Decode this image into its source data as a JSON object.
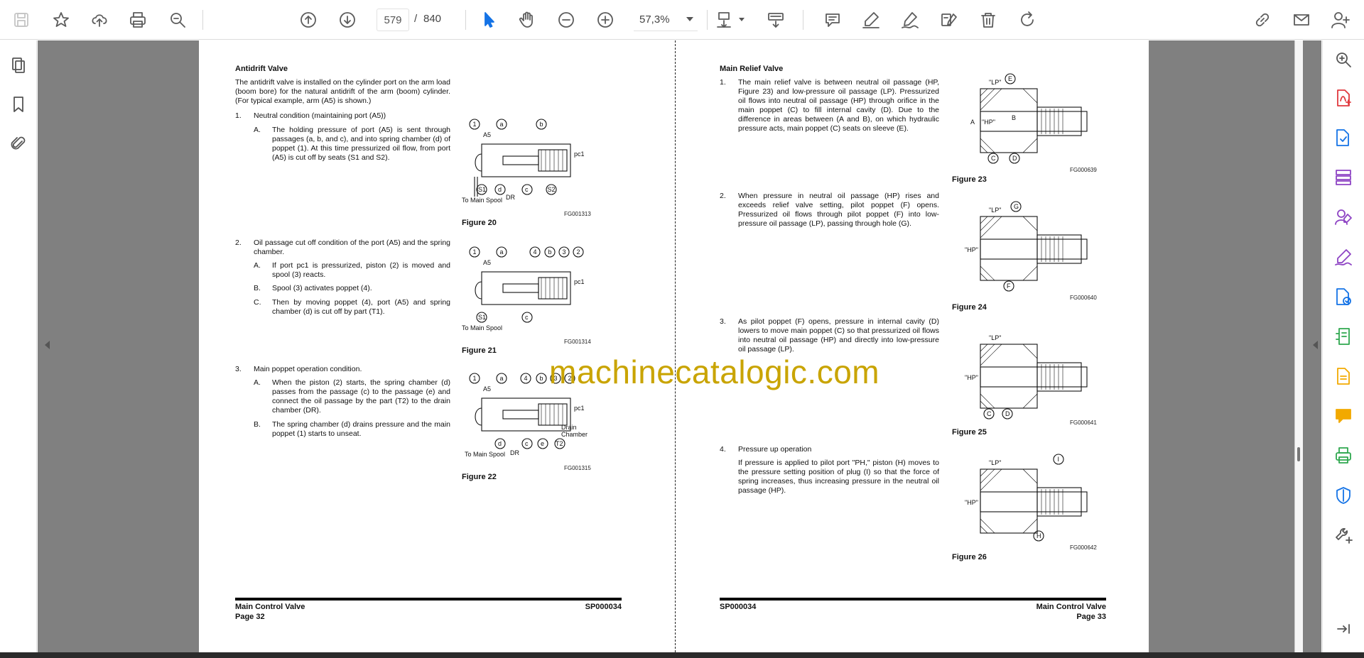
{
  "toolbar": {
    "page_current": "579",
    "page_separator": "/",
    "page_total": "840",
    "zoom": "57,3%"
  },
  "left_page": {
    "heading": "Antidrift Valve",
    "intro": "The antidrift valve is installed on the cylinder port on the arm load (boom bore) for the natural antidrift of the arm (boom) cylinder. (For typical example, arm (A5) is shown.)",
    "items": [
      {
        "num": "1.",
        "title": "Neutral condition (maintaining port (A5))",
        "subs": [
          {
            "letter": "A.",
            "text": "The holding pressure of port (A5) is sent through passages (a, b, and c), and into spring chamber (d) of poppet (1). At this time pressurized oil flow, from port (A5) is cut off by seats (S1 and S2)."
          }
        ]
      },
      {
        "num": "2.",
        "title": "Oil passage cut off condition of the port (A5) and the spring chamber.",
        "subs": [
          {
            "letter": "A.",
            "text": "If port pc1 is pressurized, piston (2) is moved and spool (3) reacts."
          },
          {
            "letter": "B.",
            "text": "Spool (3) activates poppet (4)."
          },
          {
            "letter": "C.",
            "text": "Then by moving poppet (4), port (A5) and spring chamber (d) is cut off by part (T1)."
          }
        ]
      },
      {
        "num": "3.",
        "title": "Main poppet operation condition.",
        "subs": [
          {
            "letter": "A.",
            "text": "When the piston (2) starts, the spring chamber (d) passes from the passage (c) to the passage (e) and connect the oil passage by the part (T2) to the drain chamber (DR)."
          },
          {
            "letter": "B.",
            "text": "The spring chamber (d) drains pressure and the main poppet (1) starts to unseat."
          }
        ]
      }
    ],
    "figures": [
      {
        "code": "FG001313",
        "caption": "Figure 20",
        "labels": [
          "1",
          "a",
          "b",
          "A5",
          "pc1",
          "S1",
          "d",
          "c",
          "S2",
          "DR",
          "To Main Spool"
        ]
      },
      {
        "code": "FG001314",
        "caption": "Figure 21",
        "labels": [
          "1",
          "a",
          "4",
          "b",
          "3",
          "2",
          "A5",
          "pc1",
          "S1",
          "c",
          "To Main Spool"
        ]
      },
      {
        "code": "FG001315",
        "caption": "Figure 22",
        "labels": [
          "1",
          "a",
          "4",
          "b",
          "3",
          "2",
          "A5",
          "pc1",
          "d",
          "c",
          "e",
          "T2",
          "DR",
          "Drain",
          "Chamber",
          "To Main Spool"
        ]
      }
    ],
    "footer_left_title": "Main Control Valve",
    "footer_left_page": "Page 32",
    "footer_right_code": "SP000034"
  },
  "right_page": {
    "heading": "Main Relief Valve",
    "items": [
      {
        "num": "1.",
        "text": "The main relief valve is between neutral oil passage (HP, Figure 23) and low-pressure oil passage (LP). Pressurized oil flows into neutral oil passage (HP) through orifice in the main poppet (C) to fill internal cavity (D). Due to the difference in areas between (A and B), on which hydraulic pressure acts, main poppet (C) seats on sleeve (E)."
      },
      {
        "num": "2.",
        "text": "When pressure in neutral oil passage (HP) rises and exceeds relief valve setting, pilot poppet (F) opens. Pressurized oil flows through pilot poppet (F) into low-pressure oil passage (LP), passing through hole (G)."
      },
      {
        "num": "3.",
        "text": "As pilot poppet (F) opens, pressure in internal cavity (D) lowers to move main poppet (C) so that pressurized oil flows into neutral oil passage (HP) and directly into low-pressure oil passage (LP)."
      },
      {
        "num": "4.",
        "title": "Pressure up operation",
        "text": "If pressure is applied to pilot port \"PH,\" piston (H) moves to the pressure setting position of plug (I) so that the force of spring increases, thus increasing pressure in the neutral oil passage (HP)."
      }
    ],
    "figures": [
      {
        "code": "FG000639",
        "caption": "Figure 23",
        "labels": [
          "\"LP\"",
          "E",
          "A",
          "\"HP\"",
          "B",
          "C",
          "D"
        ]
      },
      {
        "code": "FG000640",
        "caption": "Figure 24",
        "labels": [
          "\"LP\"",
          "G",
          "\"HP\"",
          "F"
        ]
      },
      {
        "code": "FG000641",
        "caption": "Figure 25",
        "labels": [
          "\"LP\"",
          "\"HP\"",
          "C",
          "D"
        ]
      },
      {
        "code": "FG000642",
        "caption": "Figure 26",
        "labels": [
          "\"LP\"",
          "I",
          "\"HP\"",
          "H"
        ]
      }
    ],
    "footer_left_code": "SP000034",
    "footer_right_title": "Main Control Valve",
    "footer_right_page": "Page 33"
  },
  "watermark": "machinecatalogic.com",
  "colors": {
    "accent": "#1473e6",
    "watermark": "#c9a400",
    "canvas": "#808080",
    "red_tool": "#e0393e",
    "purple_tool": "#8e44c4",
    "green_tool": "#2fa84f",
    "yellow_tool": "#f2a900"
  },
  "icons": {
    "toolbar": [
      "save-icon",
      "bookmark-star-icon",
      "upload-icon",
      "print-icon",
      "zoom-search-icon",
      "arrow-up-icon",
      "arrow-down-icon",
      "cursor-icon",
      "hand-icon",
      "zoom-out-icon",
      "zoom-in-icon",
      "fit-page-icon",
      "scroll-mode-icon",
      "comment-icon",
      "highlight-icon",
      "draw-icon",
      "edit-text-icon",
      "trash-icon",
      "rotate-icon",
      "share-link-icon",
      "email-icon",
      "account-icon"
    ],
    "right_rail": [
      "search-icon",
      "export-pdf-icon",
      "create-pdf-icon",
      "organize-pages-icon",
      "request-signature-icon",
      "fill-sign-icon",
      "combine-files-icon",
      "compress-pdf-icon",
      "scan-ocr-icon",
      "comment-icon",
      "print-production-icon",
      "protect-icon",
      "more-tools-icon",
      "collapse-panel-icon"
    ]
  }
}
